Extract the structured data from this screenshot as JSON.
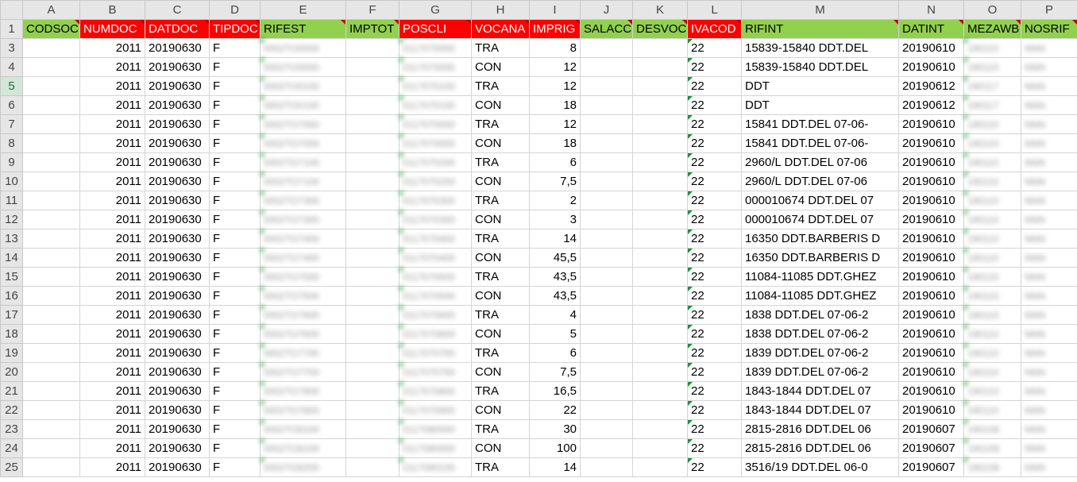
{
  "columns": [
    "A",
    "B",
    "C",
    "D",
    "E",
    "F",
    "G",
    "H",
    "I",
    "J",
    "K",
    "L",
    "M",
    "N",
    "O",
    "P"
  ],
  "headers": [
    {
      "label": "CODSOC",
      "color": "green"
    },
    {
      "label": "NUMDOC",
      "color": "red"
    },
    {
      "label": "DATDOC",
      "color": "red"
    },
    {
      "label": "TIPDOC",
      "color": "red"
    },
    {
      "label": "RIFEST",
      "color": "green"
    },
    {
      "label": "IMPTOT",
      "color": "green"
    },
    {
      "label": "POSCLI",
      "color": "red"
    },
    {
      "label": "VOCANA",
      "color": "red"
    },
    {
      "label": "IMPRIG",
      "color": "red"
    },
    {
      "label": "SALACC",
      "color": "green"
    },
    {
      "label": "DESVOC",
      "color": "green"
    },
    {
      "label": "IVACOD",
      "color": "red"
    },
    {
      "label": "RIFINT",
      "color": "green"
    },
    {
      "label": "DATINT",
      "color": "green"
    },
    {
      "label": "MEZAWB",
      "color": "green"
    },
    {
      "label": "NOSRIF",
      "color": "green"
    }
  ],
  "rows": [
    {
      "rownum": "3",
      "numdoc": "2011",
      "datdoc": "20190630",
      "tipdoc": "F",
      "rifest": "0002TO0000",
      "poscli": "0117070000",
      "vocana": "TRA",
      "imprig": "8",
      "ivacod": "22",
      "rifint": "15839-15840 DDT.DEL",
      "datint": "20190610",
      "mezawb": "190110",
      "nosrif": "NNN"
    },
    {
      "rownum": "4",
      "numdoc": "2011",
      "datdoc": "20190630",
      "tipdoc": "F",
      "rifest": "0002TO0000",
      "poscli": "0117070000",
      "vocana": "CON",
      "imprig": "12",
      "ivacod": "22",
      "rifint": "15839-15840 DDT.DEL",
      "datint": "20190610",
      "mezawb": "190110",
      "nosrif": "NNN"
    },
    {
      "rownum": "5",
      "numdoc": "2011",
      "datdoc": "20190630",
      "tipdoc": "F",
      "rifest": "0002TO0100",
      "poscli": "0117070100",
      "vocana": "TRA",
      "imprig": "12",
      "ivacod": "22",
      "rifint": "DDT",
      "datint": "20190612",
      "mezawb": "190117",
      "nosrif": "NNN"
    },
    {
      "rownum": "6",
      "numdoc": "2011",
      "datdoc": "20190630",
      "tipdoc": "F",
      "rifest": "0002TO0100",
      "poscli": "0117070100",
      "vocana": "CON",
      "imprig": "18",
      "ivacod": "22",
      "rifint": "DDT",
      "datint": "20190612",
      "mezawb": "190117",
      "nosrif": "NNN"
    },
    {
      "rownum": "7",
      "numdoc": "2011",
      "datdoc": "20190630",
      "tipdoc": "F",
      "rifest": "0002TO7000",
      "poscli": "0117070000",
      "vocana": "TRA",
      "imprig": "12",
      "ivacod": "22",
      "rifint": "15841 DDT.DEL 07-06-",
      "datint": "20190610",
      "mezawb": "190110",
      "nosrif": "NNN"
    },
    {
      "rownum": "8",
      "numdoc": "2011",
      "datdoc": "20190630",
      "tipdoc": "F",
      "rifest": "0002TO7000",
      "poscli": "0117070000",
      "vocana": "CON",
      "imprig": "18",
      "ivacod": "22",
      "rifint": "15841 DDT.DEL 07-06-",
      "datint": "20190610",
      "mezawb": "190110",
      "nosrif": "NNN"
    },
    {
      "rownum": "9",
      "numdoc": "2011",
      "datdoc": "20190630",
      "tipdoc": "F",
      "rifest": "0002TO7100",
      "poscli": "0117070200",
      "vocana": "TRA",
      "imprig": "6",
      "ivacod": "22",
      "rifint": "2960/L DDT.DEL 07-06",
      "datint": "20190610",
      "mezawb": "190110",
      "nosrif": "NNN"
    },
    {
      "rownum": "10",
      "numdoc": "2011",
      "datdoc": "20190630",
      "tipdoc": "F",
      "rifest": "0002TO7100",
      "poscli": "0117070200",
      "vocana": "CON",
      "imprig": "7,5",
      "ivacod": "22",
      "rifint": "2960/L DDT.DEL 07-06",
      "datint": "20190610",
      "mezawb": "190110",
      "nosrif": "NNN"
    },
    {
      "rownum": "11",
      "numdoc": "2011",
      "datdoc": "20190630",
      "tipdoc": "F",
      "rifest": "0002TO7300",
      "poscli": "0117070300",
      "vocana": "TRA",
      "imprig": "2",
      "ivacod": "22",
      "rifint": "000010674 DDT.DEL 07",
      "datint": "20190610",
      "mezawb": "190110",
      "nosrif": "NNN"
    },
    {
      "rownum": "12",
      "numdoc": "2011",
      "datdoc": "20190630",
      "tipdoc": "F",
      "rifest": "0002TO7300",
      "poscli": "0117070300",
      "vocana": "CON",
      "imprig": "3",
      "ivacod": "22",
      "rifint": "000010674 DDT.DEL 07",
      "datint": "20190610",
      "mezawb": "190110",
      "nosrif": "NNN"
    },
    {
      "rownum": "13",
      "numdoc": "2011",
      "datdoc": "20190630",
      "tipdoc": "F",
      "rifest": "0002TO7400",
      "poscli": "0117070400",
      "vocana": "TRA",
      "imprig": "14",
      "ivacod": "22",
      "rifint": "16350 DDT.BARBERIS D",
      "datint": "20190610",
      "mezawb": "190110",
      "nosrif": "NNN"
    },
    {
      "rownum": "14",
      "numdoc": "2011",
      "datdoc": "20190630",
      "tipdoc": "F",
      "rifest": "0002TO7400",
      "poscli": "0117070400",
      "vocana": "CON",
      "imprig": "45,5",
      "ivacod": "22",
      "rifint": "16350 DDT.BARBERIS D",
      "datint": "20190610",
      "mezawb": "190110",
      "nosrif": "NNN"
    },
    {
      "rownum": "15",
      "numdoc": "2011",
      "datdoc": "20190630",
      "tipdoc": "F",
      "rifest": "0002TO7500",
      "poscli": "0117070500",
      "vocana": "TRA",
      "imprig": "43,5",
      "ivacod": "22",
      "rifint": "11084-11085 DDT.GHEZ",
      "datint": "20190610",
      "mezawb": "190110",
      "nosrif": "NNN"
    },
    {
      "rownum": "16",
      "numdoc": "2011",
      "datdoc": "20190630",
      "tipdoc": "F",
      "rifest": "0002TO7500",
      "poscli": "0117070500",
      "vocana": "CON",
      "imprig": "43,5",
      "ivacod": "22",
      "rifint": "11084-11085 DDT.GHEZ",
      "datint": "20190610",
      "mezawb": "190110",
      "nosrif": "NNN"
    },
    {
      "rownum": "17",
      "numdoc": "2011",
      "datdoc": "20190630",
      "tipdoc": "F",
      "rifest": "0002TO7600",
      "poscli": "0117070600",
      "vocana": "TRA",
      "imprig": "4",
      "ivacod": "22",
      "rifint": "1838 DDT.DEL 07-06-2",
      "datint": "20190610",
      "mezawb": "190110",
      "nosrif": "NNN"
    },
    {
      "rownum": "18",
      "numdoc": "2011",
      "datdoc": "20190630",
      "tipdoc": "F",
      "rifest": "0002TO7600",
      "poscli": "0117070600",
      "vocana": "CON",
      "imprig": "5",
      "ivacod": "22",
      "rifint": "1838 DDT.DEL 07-06-2",
      "datint": "20190610",
      "mezawb": "190110",
      "nosrif": "NNN"
    },
    {
      "rownum": "19",
      "numdoc": "2011",
      "datdoc": "20190630",
      "tipdoc": "F",
      "rifest": "0002TO7700",
      "poscli": "0117070700",
      "vocana": "TRA",
      "imprig": "6",
      "ivacod": "22",
      "rifint": "1839 DDT.DEL 07-06-2",
      "datint": "20190610",
      "mezawb": "190110",
      "nosrif": "NNN"
    },
    {
      "rownum": "20",
      "numdoc": "2011",
      "datdoc": "20190630",
      "tipdoc": "F",
      "rifest": "0002TO7700",
      "poscli": "0117070700",
      "vocana": "CON",
      "imprig": "7,5",
      "ivacod": "22",
      "rifint": "1839 DDT.DEL 07-06-2",
      "datint": "20190610",
      "mezawb": "190110",
      "nosrif": "NNN"
    },
    {
      "rownum": "21",
      "numdoc": "2011",
      "datdoc": "20190630",
      "tipdoc": "F",
      "rifest": "0002TO7800",
      "poscli": "0117070800",
      "vocana": "TRA",
      "imprig": "16,5",
      "ivacod": "22",
      "rifint": "1843-1844 DDT.DEL 07",
      "datint": "20190610",
      "mezawb": "190110",
      "nosrif": "NNN"
    },
    {
      "rownum": "22",
      "numdoc": "2011",
      "datdoc": "20190630",
      "tipdoc": "F",
      "rifest": "0002TO7800",
      "poscli": "0117070800",
      "vocana": "CON",
      "imprig": "22",
      "ivacod": "22",
      "rifint": "1843-1844 DDT.DEL 07",
      "datint": "20190610",
      "mezawb": "190110",
      "nosrif": "NNN"
    },
    {
      "rownum": "23",
      "numdoc": "2011",
      "datdoc": "20190630",
      "tipdoc": "F",
      "rifest": "0002TO8100",
      "poscli": "0117080000",
      "vocana": "TRA",
      "imprig": "30",
      "ivacod": "22",
      "rifint": "2815-2816 DDT.DEL 06",
      "datint": "20190607",
      "mezawb": "190108",
      "nosrif": "NNN"
    },
    {
      "rownum": "24",
      "numdoc": "2011",
      "datdoc": "20190630",
      "tipdoc": "F",
      "rifest": "0002TO8100",
      "poscli": "0117080000",
      "vocana": "CON",
      "imprig": "100",
      "ivacod": "22",
      "rifint": "2815-2816 DDT.DEL 06",
      "datint": "20190607",
      "mezawb": "190108",
      "nosrif": "NNN"
    },
    {
      "rownum": "25",
      "numdoc": "2011",
      "datdoc": "20190630",
      "tipdoc": "F",
      "rifest": "0002TO8200",
      "poscli": "0117080100",
      "vocana": "TRA",
      "imprig": "14",
      "ivacod": "22",
      "rifint": "3516/19 DDT.DEL 06-0",
      "datint": "20190607",
      "mezawb": "190108",
      "nosrif": "NNN"
    }
  ]
}
